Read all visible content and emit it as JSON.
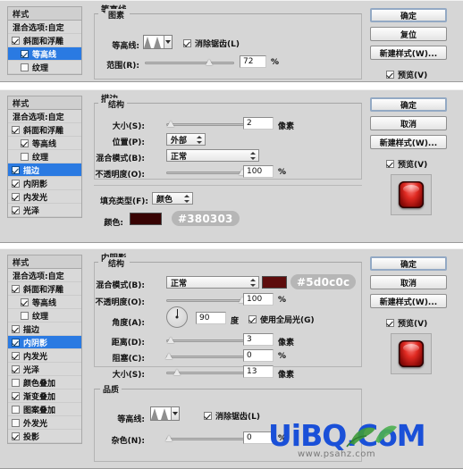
{
  "sidebar": {
    "header": "样式",
    "blending": "混合选项:自定",
    "items": [
      {
        "label": "斜面和浮雕",
        "checked": true,
        "indent": false
      },
      {
        "label": "等高线",
        "checked": true,
        "indent": true
      },
      {
        "label": "纹理",
        "checked": false,
        "indent": true
      },
      {
        "label": "描边",
        "checked": true,
        "indent": false
      },
      {
        "label": "内阴影",
        "checked": true,
        "indent": false
      },
      {
        "label": "内发光",
        "checked": true,
        "indent": false
      },
      {
        "label": "光泽",
        "checked": true,
        "indent": false
      },
      {
        "label": "颜色叠加",
        "checked": false,
        "indent": false
      },
      {
        "label": "渐变叠加",
        "checked": true,
        "indent": false
      },
      {
        "label": "图案叠加",
        "checked": false,
        "indent": false
      },
      {
        "label": "外发光",
        "checked": false,
        "indent": false
      },
      {
        "label": "投影",
        "checked": true,
        "indent": false
      }
    ]
  },
  "panel1": {
    "title": "等高线",
    "group_title": "图素",
    "contour_label": "等高线:",
    "antialias_label": "消除锯齿(L)",
    "antialias_checked": true,
    "range_label": "范围(R):",
    "range_value": "72",
    "range_unit": "%",
    "range_percent": 72,
    "buttons": [
      "确定",
      "复位",
      "新建样式(W)..."
    ],
    "preview_label": "预览(V)",
    "preview_checked": true
  },
  "panel2": {
    "title": "描边",
    "group_title": "结构",
    "size_label": "大小(S):",
    "size_value": "2",
    "size_unit": "像素",
    "size_percent": 4,
    "position_label": "位置(P):",
    "position_value": "外部",
    "blend_label": "混合模式(B):",
    "blend_value": "正常",
    "opacity_label": "不透明度(O):",
    "opacity_value": "100",
    "opacity_unit": "%",
    "opacity_percent": 100,
    "filltype_label": "填充类型(F):",
    "filltype_value": "颜色",
    "color_label": "颜色:",
    "color_hex": "#380303",
    "color_tag": "#380303",
    "buttons": [
      "确定",
      "取消",
      "新建样式(W)..."
    ],
    "preview_label": "预览(V)",
    "preview_checked": true
  },
  "panel3": {
    "title": "内阴影",
    "group_title": "结构",
    "blend_label": "混合模式(B):",
    "blend_value": "正常",
    "color_hex": "#5d0c0c",
    "color_tag": "#5d0c0c",
    "opacity_label": "不透明度(O):",
    "opacity_value": "100",
    "opacity_unit": "%",
    "opacity_percent": 100,
    "angle_label": "角度(A):",
    "angle_value": "90",
    "angle_unit": "度",
    "global_light_label": "使用全局光(G)",
    "global_light_checked": true,
    "distance_label": "距离(D):",
    "distance_value": "3",
    "distance_unit": "像素",
    "distance_percent": 3,
    "choke_label": "阻塞(C):",
    "choke_value": "0",
    "choke_unit": "%",
    "choke_percent": 0,
    "size_label": "大小(S):",
    "size_value": "13",
    "size_unit": "像素",
    "size_percent": 9,
    "quality_title": "品质",
    "contour_label": "等高线:",
    "antialias_label": "消除锯齿(L)",
    "antialias_checked": true,
    "noise_label": "杂色(N):",
    "noise_value": "0",
    "noise_unit": "%",
    "noise_percent": 0,
    "buttons": [
      "确定",
      "取消",
      "新建样式(W)..."
    ],
    "preview_label": "预览(V)",
    "preview_checked": true
  },
  "watermark": {
    "text": "UiBQ.CoM",
    "subtext": "www.psahz.com",
    "color": "#1a50d8"
  }
}
